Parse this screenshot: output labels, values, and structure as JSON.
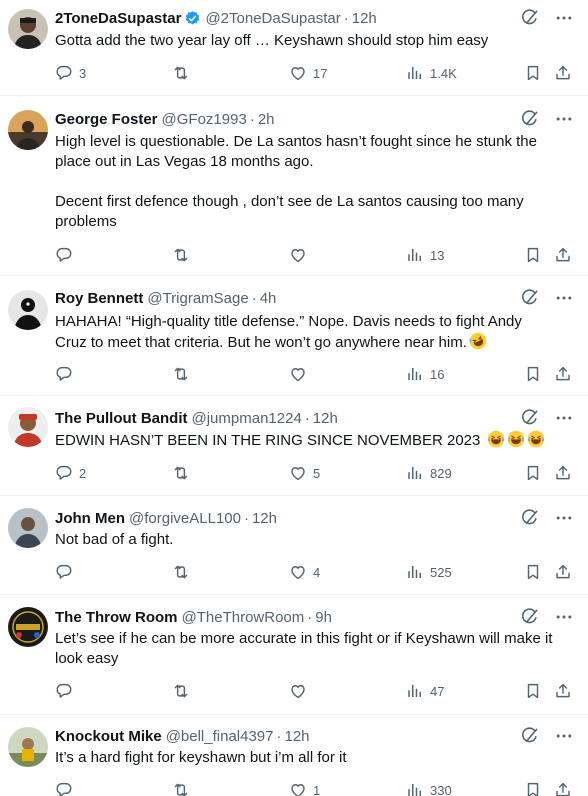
{
  "colors": {
    "text": "#0f1419",
    "secondary": "#536471",
    "verified": "#1d9bf0",
    "divider": "#eff3f4"
  },
  "icons": {
    "reply": "reply-icon",
    "retweet": "retweet-icon",
    "like": "heart-icon",
    "views": "views-icon",
    "bookmark": "bookmark-icon",
    "share": "share-icon",
    "grok": "grok-icon",
    "more": "more-icon"
  },
  "posts": [
    {
      "name": "2ToneDaSupastar",
      "handle": "@2ToneDaSupastar",
      "sep": "·",
      "time": "12h",
      "text": [
        "Gotta add the two year lay off … Keyshawn should stop him easy"
      ],
      "replies": "3",
      "retweets": "",
      "likes": "17",
      "views": "1.4K"
    },
    {
      "name": "George Foster",
      "handle": "@GFoz1993",
      "sep": "·",
      "time": "2h",
      "text": [
        "High level is questionable. De La santos hasn’t fought since he stunk the",
        "place out in Las Vegas 18 months ago.",
        "",
        "Decent first defence though , don’t see de La santos causing too many",
        "problems"
      ],
      "replies": "",
      "retweets": "",
      "likes": "",
      "views": "13"
    },
    {
      "name": "Roy Bennett",
      "handle": "@TrigramSage",
      "sep": "·",
      "time": "4h",
      "text": [
        "HAHAHA! “High-quality title defense.” Nope. Davis needs to fight Andy",
        "Cruz to meet that criteria. But he won’t go anywhere near him."
      ],
      "replies": "",
      "retweets": "",
      "likes": "",
      "views": "16"
    },
    {
      "name": "The Pullout Bandit",
      "handle": "@jumpman1224",
      "sep": "·",
      "time": "12h",
      "text": [
        "EDWIN HASN’T BEEN IN THE RING SINCE NOVEMBER 2023"
      ],
      "replies": "2",
      "retweets": "",
      "likes": "5",
      "views": "829"
    },
    {
      "name": "John Men",
      "handle": "@forgiveALL100",
      "sep": "·",
      "time": "12h",
      "text": [
        "Not bad of a fight."
      ],
      "replies": "",
      "retweets": "",
      "likes": "4",
      "views": "525"
    },
    {
      "name": "The Throw Room",
      "handle": "@TheThrowRoom",
      "sep": "·",
      "time": "9h",
      "text": [
        "Let’s see if he can be more accurate in this fight or if Keyshawn will make it",
        "look easy"
      ],
      "replies": "",
      "retweets": "",
      "likes": "",
      "views": "47"
    },
    {
      "name": "Knockout Mike",
      "handle": "@bell_final4397",
      "sep": "·",
      "time": "12h",
      "text": [
        "It’s a hard fight for keyshawn but i’m all for it"
      ],
      "replies": "",
      "retweets": "",
      "likes": "1",
      "views": "330"
    }
  ]
}
